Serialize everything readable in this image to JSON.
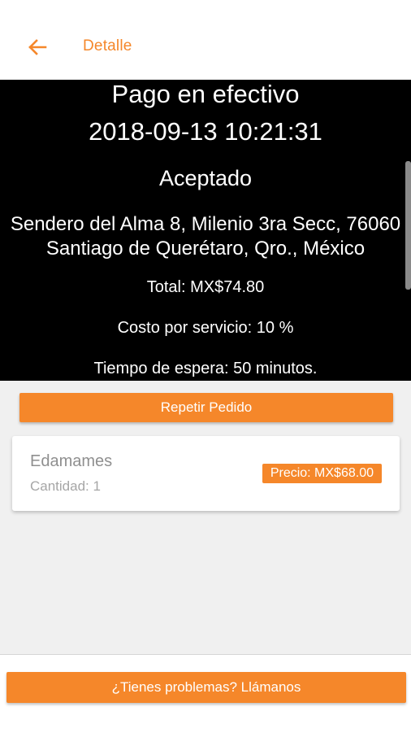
{
  "header": {
    "title": "Detalle",
    "back_icon": "arrow-left-icon"
  },
  "order": {
    "payment_method": "Pago en efectivo",
    "datetime": "2018-09-13 10:21:31",
    "status": "Aceptado",
    "address_line1": "Sendero del Alma 8, Milenio 3ra Secc, 76060",
    "address_line2": "Santiago de Querétaro, Qro., México",
    "total": "Total: MX$74.80",
    "service_fee": "Costo por servicio: 10 %",
    "wait_time": "Tiempo de espera: 50 minutos."
  },
  "actions": {
    "repeat_label": "Repetir Pedido",
    "help_label": "¿Tienes problemas? Llámanos"
  },
  "items": [
    {
      "name": "Edamames",
      "quantity": "Cantidad: 1",
      "price": "Precio: MX$68.00"
    }
  ],
  "colors": {
    "accent": "#f5872a",
    "summary_bg": "#000000",
    "content_bg": "#f0f0f0"
  }
}
